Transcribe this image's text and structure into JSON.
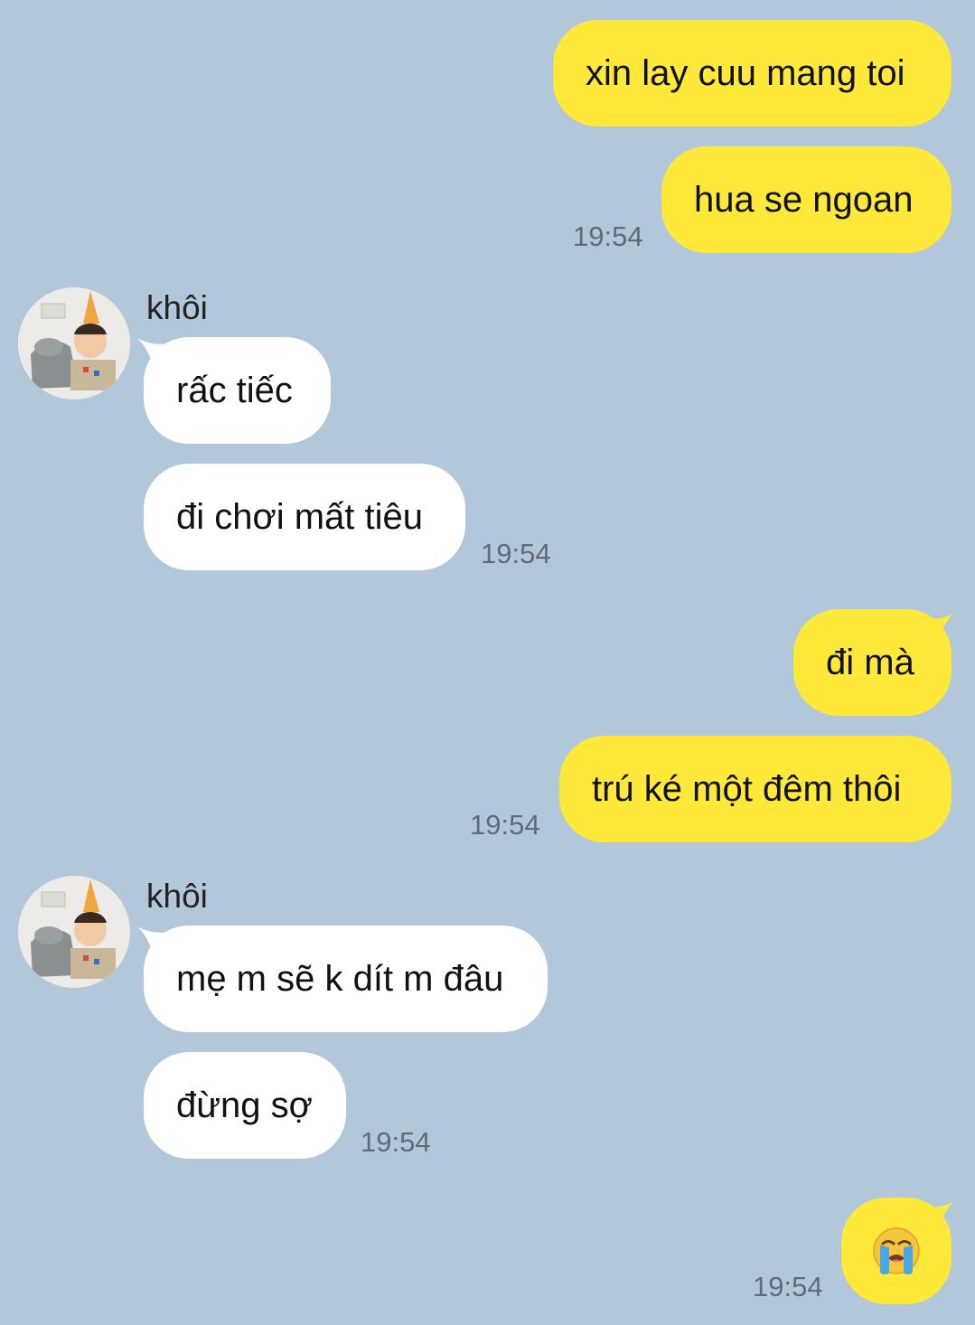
{
  "colors": {
    "background": "#b2c7da",
    "my_bubble": "#fee93a",
    "their_bubble": "#ffffff",
    "timestamp": "#5f6c78"
  },
  "messages": {
    "m1": "xin lay cuu mang toi",
    "m2": "hua se ngoan",
    "t1": "19:54",
    "sender1": "khôi",
    "m3": "rấc tiếc",
    "m4": "đi chơi mất tiêu",
    "t2": "19:54",
    "m5": "đi mà",
    "m6": "trú ké một đêm thôi",
    "t3": "19:54",
    "sender2": "khôi",
    "m7": "mẹ m sẽ k dít m đâu",
    "m8": "đừng sợ",
    "t4": "19:54",
    "m9_icon": "loudly-crying-face-emoji",
    "t5": "19:54"
  }
}
